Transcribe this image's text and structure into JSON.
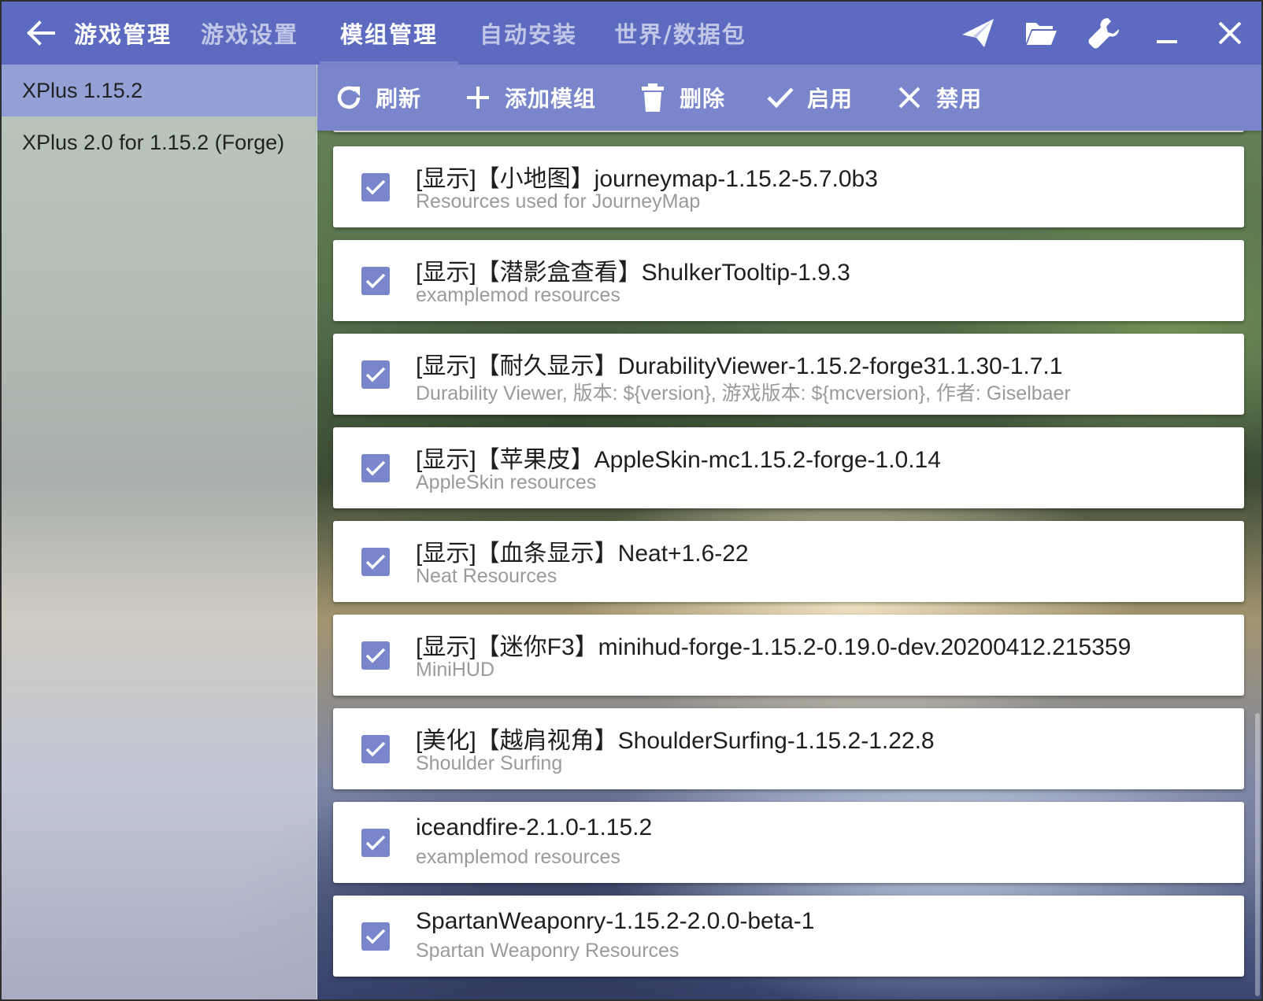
{
  "header": {
    "back_icon": "arrow-left-icon",
    "title": "游戏管理",
    "tabs": [
      {
        "label": "游戏设置"
      },
      {
        "label": "模组管理",
        "selected": true
      },
      {
        "label": "自动安装"
      },
      {
        "label": "世界/数据包"
      }
    ],
    "window_icons": [
      "send-icon",
      "folder-open-icon",
      "wrench-icon",
      "minimize-icon",
      "close-icon"
    ]
  },
  "sidebar": {
    "items": [
      {
        "label": "XPlus 1.15.2",
        "selected": true
      },
      {
        "label": "XPlus 2.0 for 1.15.2 (Forge)"
      }
    ]
  },
  "toolbar": {
    "refresh": "刷新",
    "add_mod": "添加模组",
    "delete": "删除",
    "enable": "启用",
    "disable": "禁用"
  },
  "mods": [
    {
      "name": "[显示]【小地图】journeymap-1.15.2-5.7.0b3",
      "desc": "Resources used for JourneyMap",
      "checked": true
    },
    {
      "name": "[显示]【潜影盒查看】ShulkerTooltip-1.9.3",
      "desc": "examplemod resources",
      "checked": true
    },
    {
      "name": "[显示]【耐久显示】DurabilityViewer-1.15.2-forge31.1.30-1.7.1",
      "desc": "Durability Viewer, 版本: ${version}, 游戏版本: ${mcversion}, 作者: Giselbaer",
      "checked": true
    },
    {
      "name": "[显示]【苹果皮】AppleSkin-mc1.15.2-forge-1.0.14",
      "desc": "AppleSkin resources",
      "checked": true
    },
    {
      "name": "[显示]【血条显示】Neat+1.6-22",
      "desc": "Neat Resources",
      "checked": true
    },
    {
      "name": "[显示]【迷你F3】minihud-forge-1.15.2-0.19.0-dev.20200412.215359",
      "desc": "MiniHUD",
      "checked": true
    },
    {
      "name": "[美化]【越肩视角】ShoulderSurfing-1.15.2-1.22.8",
      "desc": "Shoulder Surfing",
      "checked": true
    },
    {
      "name": "iceandfire-2.1.0-1.15.2",
      "desc": "examplemod resources",
      "checked": true
    },
    {
      "name": "SpartanWeaponry-1.15.2-2.0.0-beta-1",
      "desc": "Spartan Weaponry Resources",
      "checked": true
    }
  ],
  "colors": {
    "primary": "#5c6bc0",
    "toolbar": "#7986cb",
    "checkbox": "#7986cb",
    "sidebar_selected": "#8c9adc"
  }
}
